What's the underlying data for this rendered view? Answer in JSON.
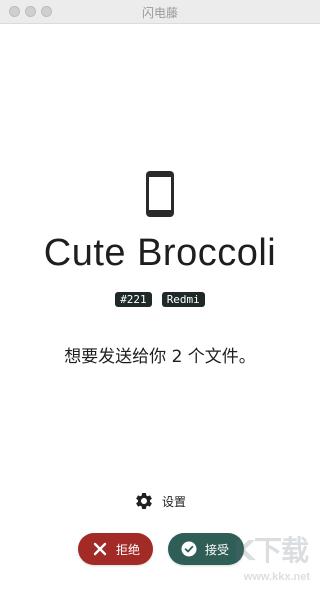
{
  "window": {
    "title": "闪电藤"
  },
  "device": {
    "icon": "smartphone-icon",
    "name": "Cute Broccoli",
    "badges": [
      "#221",
      "Redmi"
    ]
  },
  "message": "想要发送给你 2 个文件。",
  "settings": {
    "icon": "gear-icon",
    "label": "设置"
  },
  "actions": {
    "reject": {
      "label": "拒绝",
      "icon": "close-icon",
      "color": "#a32b27"
    },
    "accept": {
      "label": "接受",
      "icon": "check-circle-icon",
      "color": "#2f5e56"
    }
  },
  "watermark": {
    "mark": "K下载",
    "url": "www.kkx.net"
  }
}
